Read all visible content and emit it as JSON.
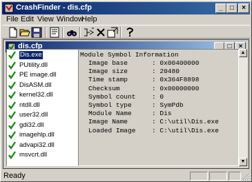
{
  "window": {
    "title": "CrashFinder - dis.cfp"
  },
  "menu": [
    {
      "label": "File"
    },
    {
      "label": "Edit"
    },
    {
      "label": "View"
    },
    {
      "label": "Window"
    },
    {
      "label": "Help"
    }
  ],
  "toolbar": {
    "buttons": [
      "new-icon",
      "open-icon",
      "save-icon",
      "properties-icon",
      "find-icon",
      "add-image-icon",
      "remove-image-icon",
      "refresh-icon",
      "help-icon"
    ]
  },
  "document": {
    "title": "dis.cfp",
    "files": [
      {
        "name": "Dis.exe",
        "selected": true
      },
      {
        "name": "PUtility.dll"
      },
      {
        "name": "PE image.dll"
      },
      {
        "name": "DisASM.dll"
      },
      {
        "name": "kernel32.dll"
      },
      {
        "name": "ntdll.dll"
      },
      {
        "name": "user32.dll"
      },
      {
        "name": "gdi32.dll"
      },
      {
        "name": "imagehlp.dll"
      },
      {
        "name": "advapi32.dll"
      },
      {
        "name": "msvcrt.dll"
      }
    ],
    "info": {
      "heading": "Module Symbol Information",
      "rows": [
        {
          "label": "Image base",
          "value": ": 0x00400000"
        },
        {
          "label": "Image size",
          "value": ": 20480"
        },
        {
          "label": "Time stamp",
          "value": ": 0x364F8898"
        },
        {
          "label": "Checksum",
          "value": ": 0x00000000"
        },
        {
          "label": "Symbol count",
          "value": ": 0"
        },
        {
          "label": "Symbol type",
          "value": ": SymPdb"
        },
        {
          "label": "Module Name",
          "value": ": Dis"
        },
        {
          "label": "Image Name",
          "value": ": C:\\util\\Dis.exe"
        },
        {
          "label": "Loaded Image",
          "value": ": C:\\util\\Dis.exe"
        }
      ]
    }
  },
  "status": {
    "text": "Ready"
  },
  "colors": {
    "title_active": "#0a246a",
    "face": "#d4d0c8",
    "check": "#1a8a1a"
  }
}
